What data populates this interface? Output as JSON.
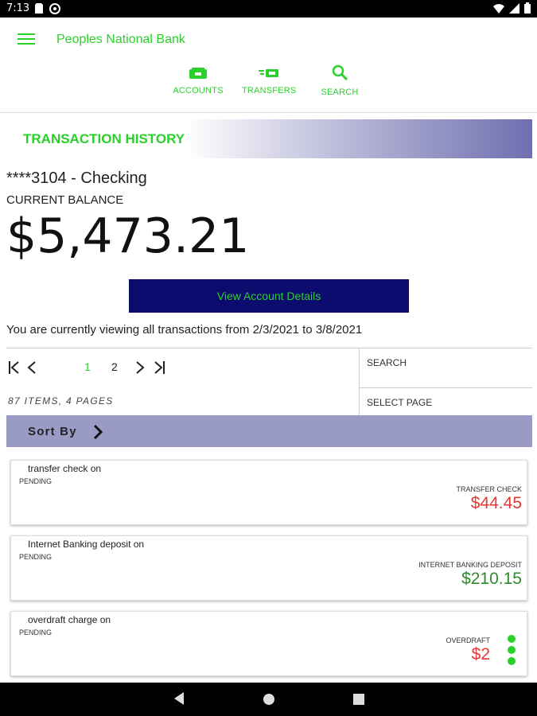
{
  "status_bar": {
    "time": "7:13"
  },
  "app": {
    "bank_name": "Peoples National Bank"
  },
  "nav": [
    {
      "label": "ACCOUNTS",
      "icon": "accounts-icon"
    },
    {
      "label": "TRANSFERS",
      "icon": "transfers-icon"
    },
    {
      "label": "SEARCH",
      "icon": "search-icon"
    }
  ],
  "banner": {
    "title": "TRANSACTION HISTORY"
  },
  "account": {
    "name": "****3104 - Checking",
    "balance_label": "CURRENT BALANCE",
    "balance": "$5,473.21"
  },
  "details_button": "View Account Details",
  "range_text": "You are currently viewing all transactions from 2/3/2021 to 3/8/2021",
  "pager": {
    "pages": [
      "1",
      "2"
    ],
    "current": "1",
    "items_count": "87 ITEMS, 4 PAGES",
    "search_label": "SEARCH",
    "select_page_label": "SELECT PAGE"
  },
  "sort_label": "Sort By",
  "transactions": [
    {
      "description": "transfer check on",
      "status": "PENDING",
      "type": "TRANSFER CHECK",
      "amount": "$44.45",
      "sign": "negative"
    },
    {
      "description": "Internet Banking deposit on",
      "status": "PENDING",
      "type": "INTERNET BANKING DEPOSIT",
      "amount": "$210.15",
      "sign": "positive"
    },
    {
      "description": "overdraft charge on",
      "status": "PENDING",
      "type": "OVERDRAFT",
      "amount": "$2",
      "sign": "negative"
    }
  ],
  "colors": {
    "accent": "#2ad12a",
    "navy": "#0c0c6e",
    "sort_bar": "#9a9ac6",
    "negative": "#e53935",
    "positive": "#2e8b2e"
  }
}
